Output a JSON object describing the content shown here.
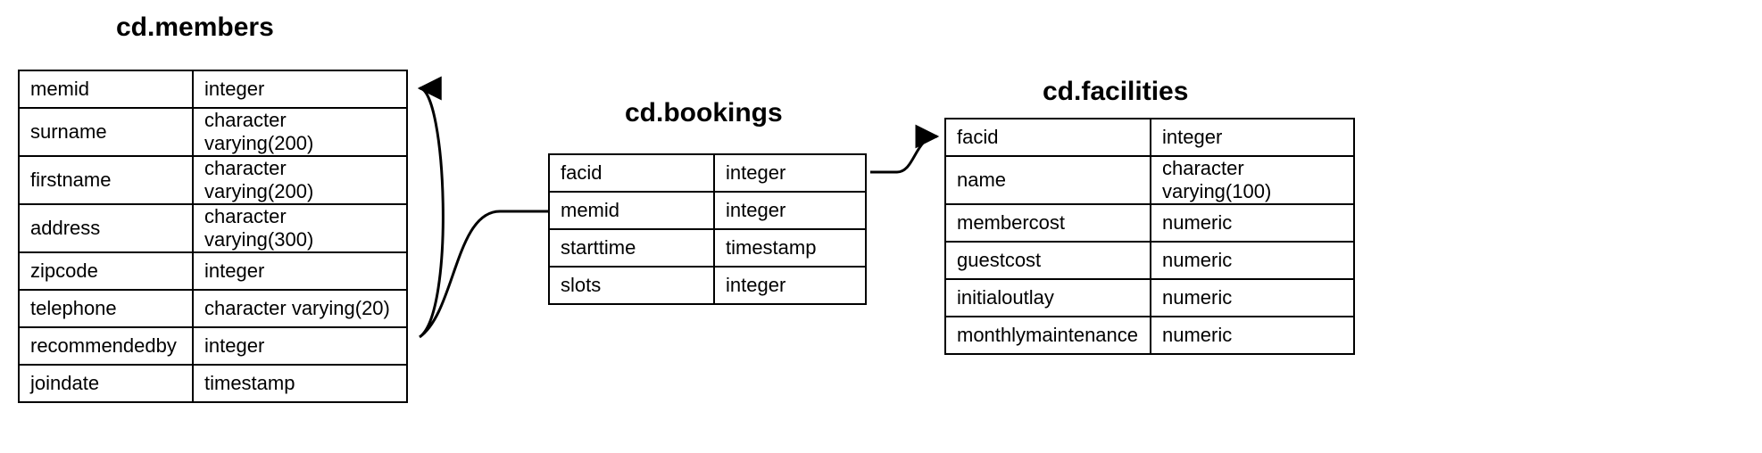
{
  "tables": {
    "members": {
      "title": "cd.members",
      "columns": [
        {
          "name": "memid",
          "type": "integer"
        },
        {
          "name": "surname",
          "type": "character varying(200)"
        },
        {
          "name": "firstname",
          "type": "character varying(200)"
        },
        {
          "name": "address",
          "type": "character varying(300)"
        },
        {
          "name": "zipcode",
          "type": "integer"
        },
        {
          "name": "telephone",
          "type": "character varying(20)"
        },
        {
          "name": "recommendedby",
          "type": "integer"
        },
        {
          "name": "joindate",
          "type": "timestamp"
        }
      ]
    },
    "bookings": {
      "title": "cd.bookings",
      "columns": [
        {
          "name": "facid",
          "type": "integer"
        },
        {
          "name": "memid",
          "type": "integer"
        },
        {
          "name": "starttime",
          "type": "timestamp"
        },
        {
          "name": "slots",
          "type": "integer"
        }
      ]
    },
    "facilities": {
      "title": "cd.facilities",
      "columns": [
        {
          "name": "facid",
          "type": "integer"
        },
        {
          "name": "name",
          "type": "character varying(100)"
        },
        {
          "name": "membercost",
          "type": "numeric"
        },
        {
          "name": "guestcost",
          "type": "numeric"
        },
        {
          "name": "initialoutlay",
          "type": "numeric"
        },
        {
          "name": "monthlymaintenance",
          "type": "numeric"
        }
      ]
    }
  }
}
